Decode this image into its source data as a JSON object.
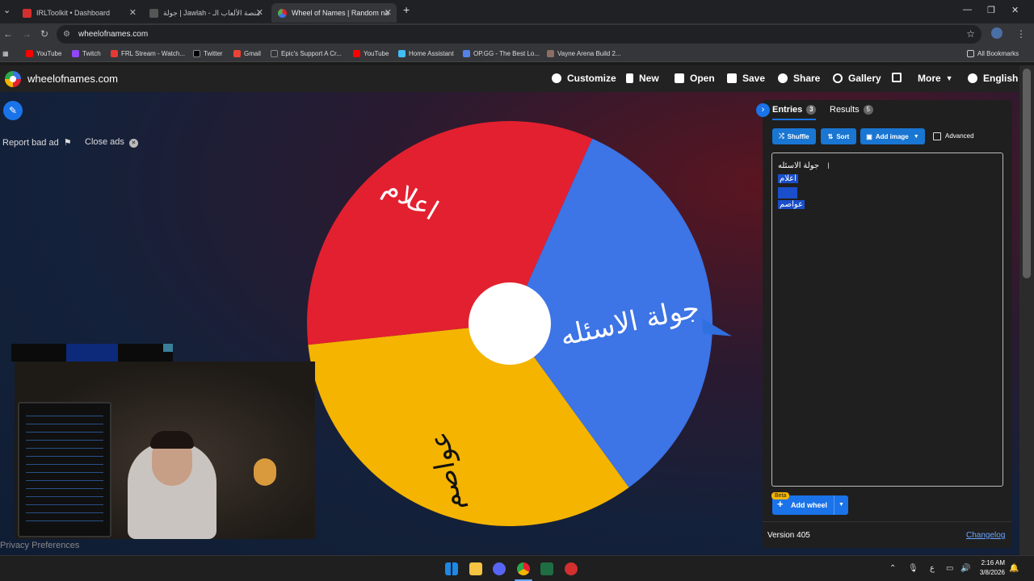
{
  "browser": {
    "tabs": [
      {
        "title": "IRLToolkit • Dashboard",
        "fav_color": "#d32f2f"
      },
      {
        "title": "جولة | Jawlah - منصة الألعاب الـ",
        "fav_color": "#555555"
      },
      {
        "title": "Wheel of Names | Random nam",
        "fav_color": "#4caf50"
      }
    ],
    "url": "wheelofnames.com",
    "bookmarks": [
      {
        "label": "YouTube",
        "color": "#ff0000"
      },
      {
        "label": "Twitch",
        "color": "#9146ff"
      },
      {
        "label": "FRL Stream - Watch...",
        "color": "#e53935"
      },
      {
        "label": "Twitter",
        "color": "#000000"
      },
      {
        "label": "Gmail",
        "color": "#ea4335"
      },
      {
        "label": "Epic's Support A Cr...",
        "color": "#333333"
      },
      {
        "label": "YouTube",
        "color": "#ff0000"
      },
      {
        "label": "Home Assistant",
        "color": "#41bdf5"
      },
      {
        "label": "OP.GG - The Best Lo...",
        "color": "#5383e8"
      },
      {
        "label": "Vayne Arena Build 2...",
        "color": "#8d6e63"
      }
    ],
    "all_bookmarks": "All Bookmarks"
  },
  "app": {
    "logo_text": "wheelofnames.com",
    "menu": [
      "Customize",
      "New",
      "Open",
      "Save",
      "Share",
      "Gallery",
      "More",
      "English"
    ],
    "report_bad_ad": "Report bad ad",
    "close_ads": "Close ads",
    "privacy": "Privacy Preferences"
  },
  "wheel": {
    "segments": [
      {
        "label": "جولة الاسئله",
        "color": "#3d74e6"
      },
      {
        "label": "عواصم",
        "color": "#f4b400"
      },
      {
        "label": "اعلام",
        "color": "#e3202f"
      }
    ],
    "pointer_color": "#2f6fde"
  },
  "panel": {
    "tab_entries": "Entries",
    "entries_count": "3",
    "tab_results": "Results",
    "results_count": "5",
    "shuffle": "Shuffle",
    "sort": "Sort",
    "add_image": "Add image",
    "advanced": "Advanced",
    "entries": [
      "جولة الاسئله",
      "اعلام",
      "عواصم"
    ],
    "beta": "Beta",
    "add_wheel": "Add wheel",
    "version": "Version 405",
    "changelog": "Changelog"
  },
  "taskbar": {
    "time": "2:16 AM",
    "date": "3/8/2026",
    "lang": "ع"
  }
}
